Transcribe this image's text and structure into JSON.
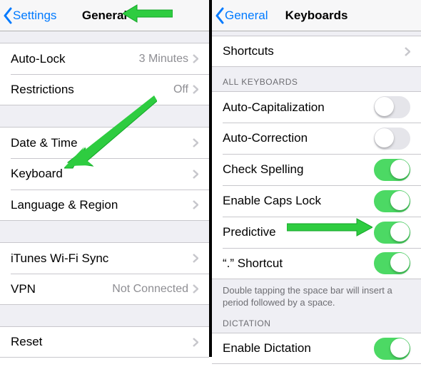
{
  "left": {
    "nav": {
      "back": "Settings",
      "title": "General"
    },
    "cells": {
      "autolock": {
        "label": "Auto-Lock",
        "value": "3 Minutes"
      },
      "restrictions": {
        "label": "Restrictions",
        "value": "Off"
      },
      "datetime": {
        "label": "Date & Time"
      },
      "keyboard": {
        "label": "Keyboard"
      },
      "language": {
        "label": "Language & Region"
      },
      "ituneswifi": {
        "label": "iTunes Wi-Fi Sync"
      },
      "vpn": {
        "label": "VPN",
        "value": "Not Connected"
      },
      "reset": {
        "label": "Reset"
      }
    }
  },
  "right": {
    "nav": {
      "back": "General",
      "title": "Keyboards"
    },
    "cells": {
      "shortcuts": {
        "label": "Shortcuts"
      },
      "autocap": {
        "label": "Auto-Capitalization",
        "on": false
      },
      "autocorr": {
        "label": "Auto-Correction",
        "on": false
      },
      "spelling": {
        "label": "Check Spelling",
        "on": true
      },
      "capslock": {
        "label": "Enable Caps Lock",
        "on": true
      },
      "predictive": {
        "label": "Predictive",
        "on": true
      },
      "period": {
        "label": "“.” Shortcut",
        "on": true
      },
      "dictation": {
        "label": "Enable Dictation",
        "on": true
      }
    },
    "headers": {
      "allkb": "ALL KEYBOARDS",
      "dict": "DICTATION"
    },
    "footers": {
      "period": "Double tapping the space bar will insert a period followed by a space."
    }
  }
}
